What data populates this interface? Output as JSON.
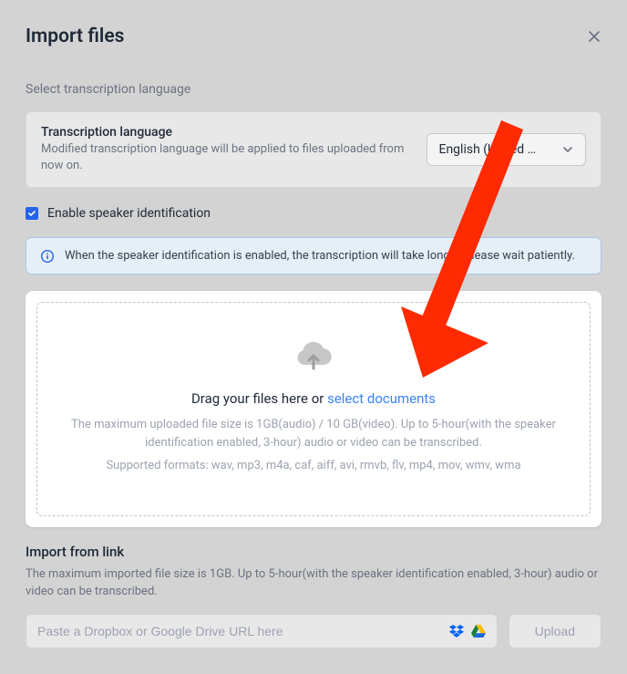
{
  "header": {
    "title": "Import files"
  },
  "language": {
    "section_label": "Select transcription language",
    "title": "Transcription language",
    "description": "Modified transcription language will be applied to files uploaded from now on.",
    "selected": "English (United …"
  },
  "speaker": {
    "checkbox_label": "Enable speaker identification",
    "checked": true,
    "banner_text": "When the speaker identification is enabled, the transcription will take longer, please wait patiently."
  },
  "dropzone": {
    "prompt_prefix": "Drag your files here or ",
    "select_link": "select documents",
    "maxsize_text": "The maximum uploaded file size is 1GB(audio) / 10 GB(video). Up to 5-hour(with the speaker identification enabled, 3-hour) audio or video can be transcribed.",
    "formats_text": "Supported formats: wav, mp3, m4a, caf, aiff, avi, rmvb, flv, mp4, mov, wmv, wma"
  },
  "import_link": {
    "title": "Import from link",
    "description": "The maximum imported file size is 1GB. Up to 5-hour(with the speaker identification enabled, 3-hour) audio or video can be transcribed.",
    "placeholder": "Paste a Dropbox or Google Drive URL here",
    "upload_label": "Upload"
  },
  "annotation": {
    "arrow_color": "#ff2a00"
  }
}
